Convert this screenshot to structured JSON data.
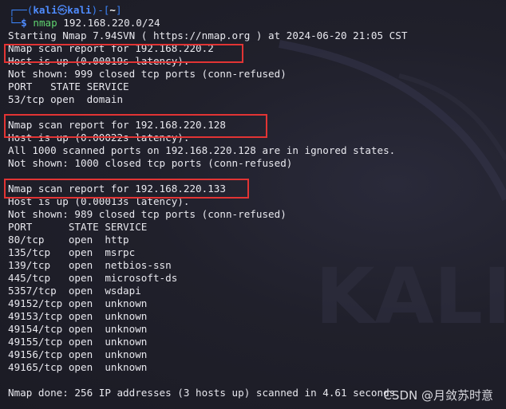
{
  "colors": {
    "background": "#1f1f2a",
    "text": "#e8e8ee",
    "prompt_blue": "#4f8cff",
    "command_green": "#5fd36f",
    "highlight_red": "#e23434"
  },
  "prompt": {
    "corner_top": "┌──(",
    "user": "kali",
    "skull_icon": "㉿",
    "host": "kali",
    "sep": ")-[",
    "dir": "~",
    "close": "]",
    "corner_bottom": "└─",
    "dollar": "$",
    "command": "nmap",
    "args": "192.168.220.0/24"
  },
  "output": {
    "start": "Starting Nmap 7.94SVN ( https://nmap.org ) at 2024-06-20 21:05 CST",
    "host1": {
      "report": "Nmap scan report for 192.168.220.2",
      "up": "Host is up (0.00019s latency).",
      "not_shown": "Not shown: 999 closed tcp ports (conn-refused)",
      "header": "PORT   STATE SERVICE",
      "ports": [
        "53/tcp open  domain"
      ]
    },
    "host2": {
      "report": "Nmap scan report for 192.168.220.128",
      "up": "Host is up (0.00022s latency).",
      "all": "All 1000 scanned ports on 192.168.220.128 are in ignored states.",
      "not_shown": "Not shown: 1000 closed tcp ports (conn-refused)"
    },
    "host3": {
      "report": "Nmap scan report for 192.168.220.133",
      "up": "Host is up (0.00013s latency).",
      "not_shown": "Not shown: 989 closed tcp ports (conn-refused)",
      "header": "PORT      STATE SERVICE",
      "ports": [
        "80/tcp    open  http",
        "135/tcp   open  msrpc",
        "139/tcp   open  netbios-ssn",
        "445/tcp   open  microsoft-ds",
        "5357/tcp  open  wsdapi",
        "49152/tcp open  unknown",
        "49153/tcp open  unknown",
        "49154/tcp open  unknown",
        "49155/tcp open  unknown",
        "49156/tcp open  unknown",
        "49165/tcp open  unknown"
      ]
    },
    "done": "Nmap done: 256 IP addresses (3 hosts up) scanned in 4.61 seconds"
  },
  "background_logo": "KALI",
  "watermark": "CSDN @月敛苏时意"
}
